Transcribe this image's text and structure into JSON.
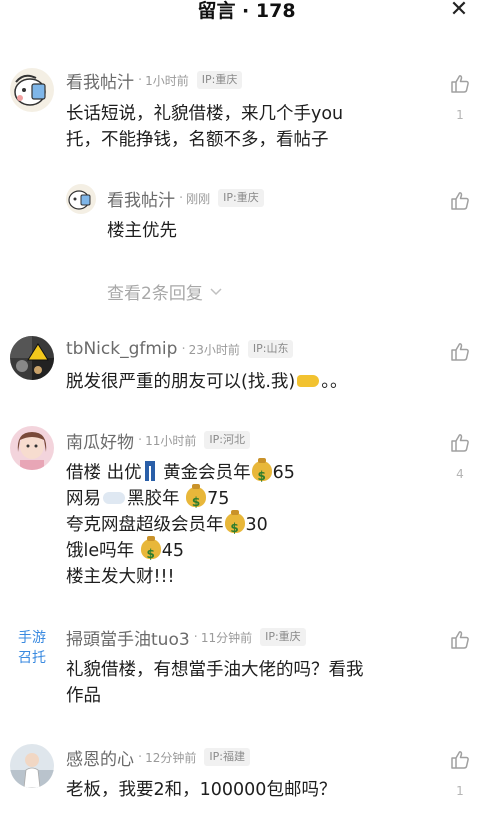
{
  "header": {
    "title": "留言 · 178",
    "close_icon": "close-icon"
  },
  "comments": [
    {
      "username": "看我帖汁",
      "time": "1小时前",
      "ip": "IP:重庆",
      "lines": [
        "长话短说，礼貌借楼，来几个手you",
        "托，不能挣钱，名额不多，看帖子"
      ],
      "likes": "1",
      "reply": {
        "username": "看我帖汁",
        "time": "刚刚",
        "ip": "IP:重庆",
        "text": "楼主优先"
      },
      "more_replies": "查看2条回复"
    },
    {
      "username": "tbNick_gfmip",
      "time": "23小时前",
      "ip": "IP:山东",
      "text": "脱发很严重的朋友可以(找.我)",
      "text_tail": "。。",
      "likes": ""
    },
    {
      "username": "南瓜好物",
      "time": "11小时前",
      "ip": "IP:河北",
      "lines": [
        {
          "a": "借楼 出优",
          "b": " 黄金会员年",
          "c": "65"
        },
        {
          "a": "网易",
          "b": "黑胶年 ",
          "c": "75"
        },
        {
          "a": "夸克网盘超级会员年",
          "b": "",
          "c": "30"
        },
        {
          "a": "饿le吗年 ",
          "b": "",
          "c": "45"
        },
        {
          "a": "楼主发大财!!!",
          "b": "",
          "c": ""
        }
      ],
      "likes": "4"
    },
    {
      "side_tag": [
        "手游",
        "召托"
      ],
      "username": "掃頭當手油tuo3",
      "time": "11分钟前",
      "ip": "IP:重庆",
      "lines": [
        "礼貌借楼，有想當手油大佬的吗？看我",
        "作品"
      ],
      "likes": ""
    },
    {
      "username": "感恩的心",
      "time": "12分钟前",
      "ip": "IP:福建",
      "text": "老板，我要2和，100000包邮吗？",
      "likes": "1"
    }
  ],
  "icons": {
    "like": "thumbs-up-icon",
    "chevron": "chevron-down-icon",
    "money_bag": "money-bag-icon"
  },
  "colors": {
    "username": "#6b6b6b",
    "link": "#3a8ae0",
    "meta": "#9a9a9a"
  }
}
